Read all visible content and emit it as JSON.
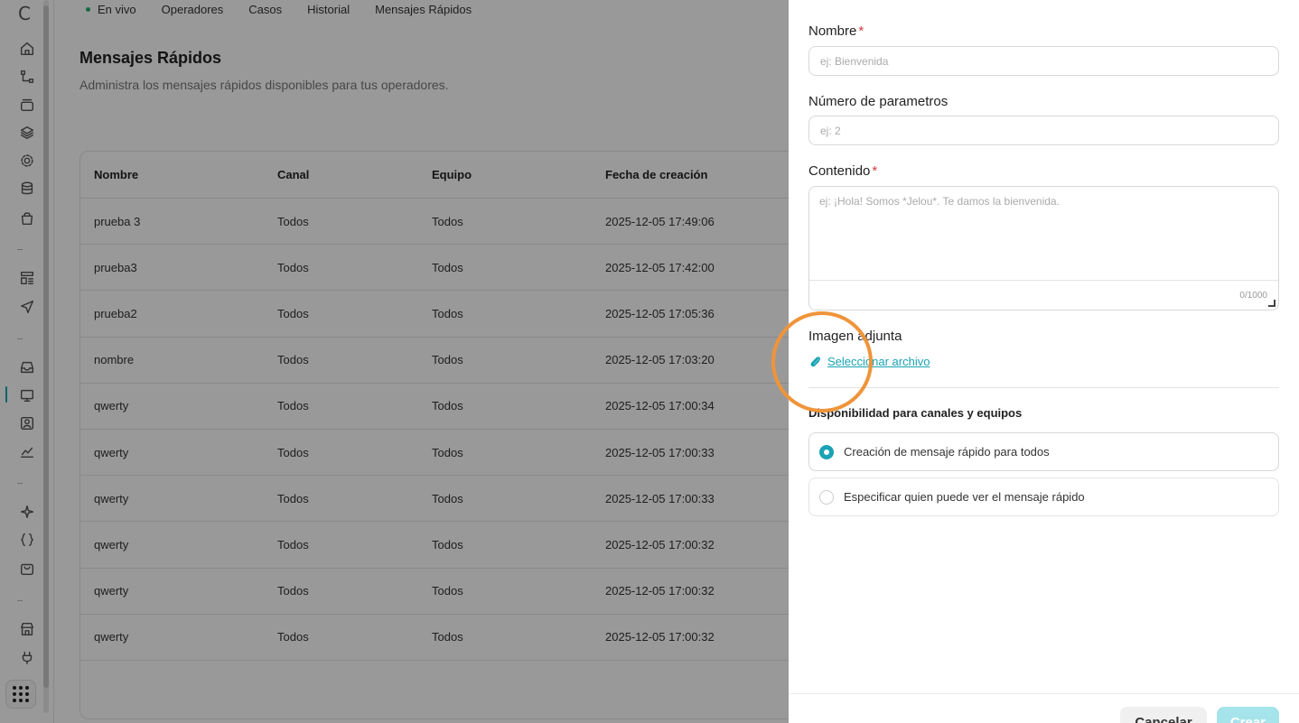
{
  "sidebar": {
    "logo": "C",
    "icons": [
      "home-icon",
      "flow-icon",
      "inbox-stack-icon",
      "layers-icon",
      "gear-icon",
      "database-icon",
      "bag-icon",
      "template-icon",
      "send-icon",
      "inbox-icon",
      "monitor-icon",
      "contact-icon",
      "chart-icon",
      "sparkle-icon",
      "code-braces-icon",
      "shop-bag-icon",
      "store-icon",
      "plug-icon",
      "apps-grid-icon"
    ]
  },
  "topnav": {
    "items": [
      "En vivo",
      "Operadores",
      "Casos",
      "Historial",
      "Mensajes Rápidos"
    ]
  },
  "page": {
    "title": "Mensajes Rápidos",
    "subtitle": "Administra los mensajes rápidos disponibles para tus operadores."
  },
  "table": {
    "headers": [
      "Nombre",
      "Canal",
      "Equipo",
      "Fecha de creación"
    ],
    "rows": [
      [
        "prueba 3",
        "Todos",
        "Todos",
        "2025-12-05 17:49:06"
      ],
      [
        "prueba3",
        "Todos",
        "Todos",
        "2025-12-05 17:42:00"
      ],
      [
        "prueba2",
        "Todos",
        "Todos",
        "2025-12-05 17:05:36"
      ],
      [
        "nombre",
        "Todos",
        "Todos",
        "2025-12-05 17:03:20"
      ],
      [
        "qwerty",
        "Todos",
        "Todos",
        "2025-12-05 17:00:34"
      ],
      [
        "qwerty",
        "Todos",
        "Todos",
        "2025-12-05 17:00:33"
      ],
      [
        "qwerty",
        "Todos",
        "Todos",
        "2025-12-05 17:00:33"
      ],
      [
        "qwerty",
        "Todos",
        "Todos",
        "2025-12-05 17:00:32"
      ],
      [
        "qwerty",
        "Todos",
        "Todos",
        "2025-12-05 17:00:32"
      ],
      [
        "qwerty",
        "Todos",
        "Todos",
        "2025-12-05 17:00:32"
      ]
    ]
  },
  "drawer": {
    "name_label": "Nombre",
    "name_placeholder": "ej: Bienvenida",
    "params_label": "Número de parametros",
    "params_placeholder": "ej: 2",
    "content_label": "Contenido",
    "content_placeholder": "ej: ¡Hola! Somos *Jelou*. Te damos la bienvenida.",
    "content_counter": "0/1000",
    "required_mark": "*",
    "image_label": "Imagen adjunta",
    "attach_link": "Seleccionar archivo",
    "availability_title": "Disponibilidad para canales y equipos",
    "option_all": "Creación de mensaje rápido para todos",
    "option_specific": "Especificar quien puede ver el mensaje rápido",
    "selected_option": "all",
    "cancel_label": "Cancelar",
    "create_label": "Crear"
  },
  "colors": {
    "accent": "#19a3b4",
    "required": "#d23b3b",
    "highlight": "#f0943a",
    "live": "#2ab36b"
  }
}
